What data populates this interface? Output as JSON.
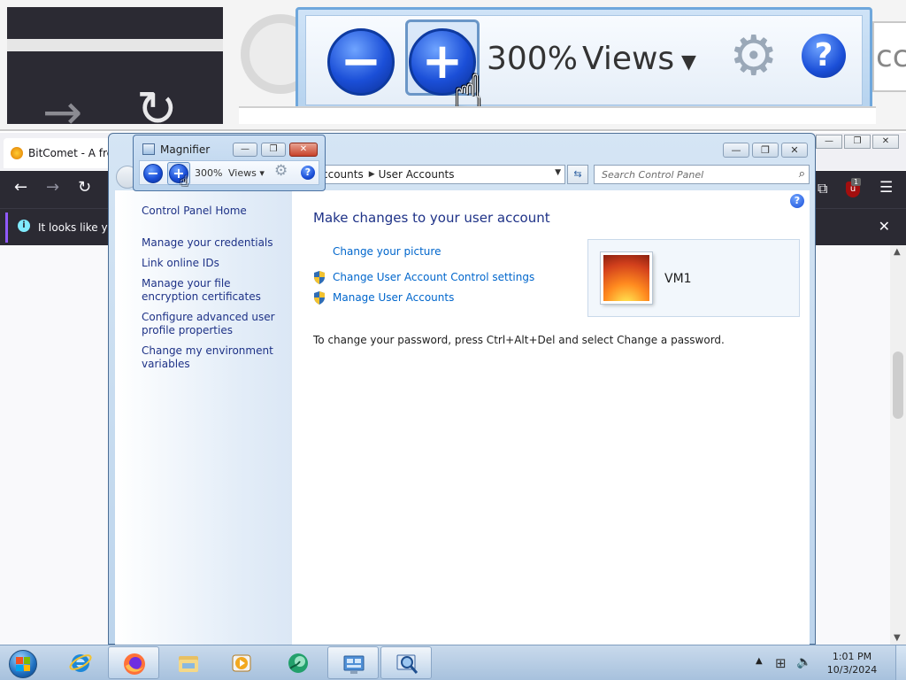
{
  "lens": {
    "zoom_text": "300%",
    "views_text": "Views",
    "partial_text": "cc"
  },
  "firefox": {
    "tab_title": "BitComet - A free",
    "notice_text": "It looks like you",
    "close_symbol": "✕",
    "window_buttons": [
      "—",
      "❐",
      "✕"
    ],
    "ublock_badge": "1",
    "nav_icons": [
      "arrow-left-icon",
      "arrow-right-icon",
      "reload-icon",
      "extensions-icon",
      "ublock-icon",
      "menu-icon"
    ]
  },
  "control_panel": {
    "breadcrumb": [
      "ccounts",
      "User Accounts"
    ],
    "search_placeholder": "Search Control Panel",
    "sidebar": {
      "home": "Control Panel Home",
      "links": [
        "Manage your credentials",
        "Link online IDs",
        "Manage your file encryption certificates",
        "Configure advanced user profile properties",
        "Change my environment variables"
      ]
    },
    "heading": "Make changes to your user account",
    "tasks": [
      "Change your picture",
      "Change User Account Control settings",
      "Manage User Accounts"
    ],
    "note": "To change your password, press Ctrl+Alt+Del and select Change a password.",
    "user_name": "VM1",
    "window_buttons": [
      "—",
      "❐",
      "✕"
    ]
  },
  "magnifier": {
    "title": "Magnifier",
    "zoom_level": "300%",
    "views_label": "Views",
    "minus_symbol": "−",
    "plus_symbol": "+",
    "help_symbol": "?"
  },
  "taskbar": {
    "pinned": [
      "internet-explorer-icon",
      "firefox-icon",
      "file-explorer-icon",
      "media-player-icon",
      "bitcomet-icon",
      "control-panel-icon",
      "magnifier-icon"
    ],
    "active": [
      "firefox-icon",
      "control-panel-icon",
      "magnifier-icon"
    ],
    "time": "1:01 PM",
    "date": "10/3/2024"
  },
  "colors": {
    "link_blue": "#0066cc",
    "sidebar_link": "#1e3287",
    "firefox_dark": "#2b2a33",
    "win7_chrome": "#bcd4ec"
  }
}
